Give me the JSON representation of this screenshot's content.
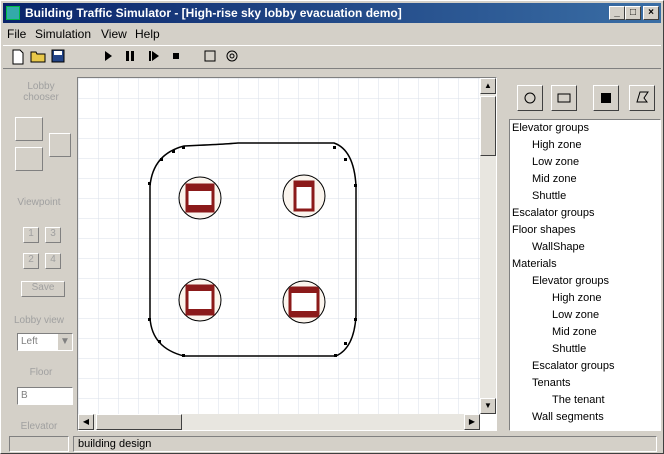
{
  "window": {
    "title": "Building Traffic Simulator - [High-rise sky lobby evacuation demo]",
    "controls": [
      "_",
      "□",
      "×"
    ]
  },
  "menu": [
    "File",
    "Simulation",
    "View",
    "Help"
  ],
  "toolbar": {
    "icons": [
      "new-file-icon",
      "open-folder-icon",
      "save-icon",
      "play-icon",
      "pause-icon",
      "step-icon",
      "stop-icon",
      "square-icon",
      "spiral-icon"
    ]
  },
  "left_panel": {
    "lobby_chooser": "Lobby chooser",
    "viewpoint": "Viewpoint",
    "view_buttons": [
      "1",
      "2",
      "3",
      "4"
    ],
    "save_label": "Save",
    "lobby_view": "Lobby view",
    "lobby_view_value": "Left",
    "floor": "Floor",
    "floor_value": "B",
    "elevator": "Elevator"
  },
  "tree": [
    {
      "label": "Elevator groups",
      "level": 0
    },
    {
      "label": "High zone",
      "level": 1
    },
    {
      "label": "Low zone",
      "level": 1
    },
    {
      "label": "Mid zone",
      "level": 1
    },
    {
      "label": "Shuttle",
      "level": 1
    },
    {
      "label": "Escalator groups",
      "level": 0
    },
    {
      "label": "Floor shapes",
      "level": 0
    },
    {
      "label": "WallShape",
      "level": 1
    },
    {
      "label": "Materials",
      "level": 0
    },
    {
      "label": "Elevator groups",
      "level": 1
    },
    {
      "label": "High zone",
      "level": 2
    },
    {
      "label": "Low zone",
      "level": 2
    },
    {
      "label": "Mid zone",
      "level": 2
    },
    {
      "label": "Shuttle",
      "level": 2
    },
    {
      "label": "Escalator groups",
      "level": 1
    },
    {
      "label": "Tenants",
      "level": 1
    },
    {
      "label": "The tenant",
      "level": 2
    },
    {
      "label": "Wall segments",
      "level": 1
    }
  ],
  "status": {
    "text": "building design"
  },
  "colors": {
    "title_start": "#0a246a",
    "title_end": "#3a6ea5",
    "grid": "#d8dfe8",
    "elevator": "#8b1a1a"
  }
}
